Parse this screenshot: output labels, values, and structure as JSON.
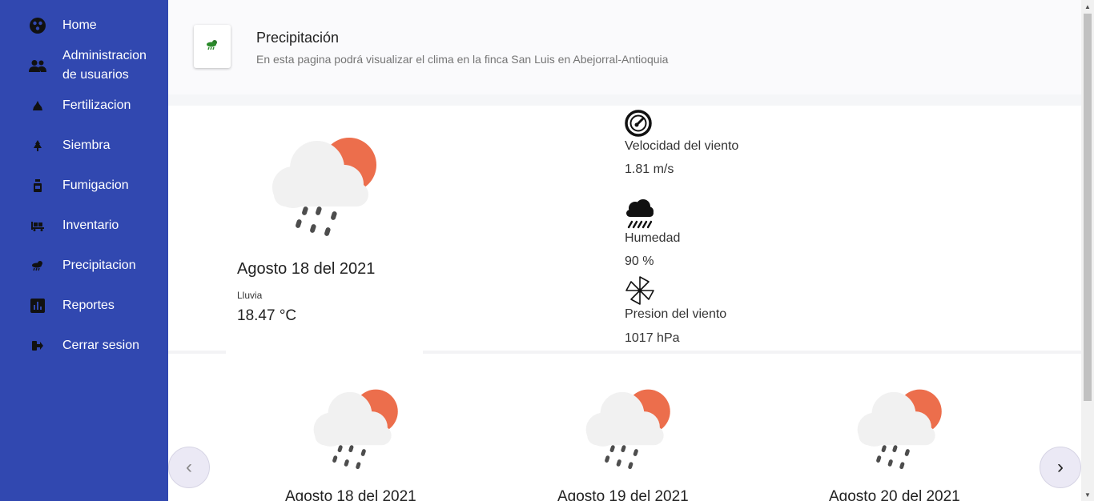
{
  "sidebar": {
    "items": [
      {
        "label": "Home",
        "icon": "home-icon"
      },
      {
        "label": "Administracion",
        "label2": "de usuarios",
        "icon": "users-icon"
      },
      {
        "label": "Fertilizacion",
        "icon": "fertilizer-icon"
      },
      {
        "label": "Siembra",
        "icon": "plant-icon"
      },
      {
        "label": "Fumigacion",
        "icon": "spray-icon"
      },
      {
        "label": "Inventario",
        "icon": "inventory-icon"
      },
      {
        "label": "Precipitacion",
        "icon": "rain-icon"
      },
      {
        "label": "Reportes",
        "icon": "chart-icon"
      },
      {
        "label": "Cerrar sesion",
        "icon": "logout-icon"
      }
    ]
  },
  "header": {
    "title": "Precipitación",
    "subtitle": "En esta pagina podrá visualizar el clima en la finca San Luis en Abejorral-Antioquia"
  },
  "current": {
    "date": "Agosto 18 del 2021",
    "condition": "Lluvia",
    "temperature": "18.47 °C"
  },
  "stats": {
    "wind_speed_label": "Velocidad del viento",
    "wind_speed_value": "1.81 m/s",
    "humidity_label": "Humedad",
    "humidity_value": "90 %",
    "pressure_label": "Presion del viento",
    "pressure_value": "1017 hPa"
  },
  "forecast": [
    {
      "date": "Agosto 18 del 2021"
    },
    {
      "date": "Agosto 19 del 2021"
    },
    {
      "date": "Agosto 20 del 2021"
    }
  ],
  "carousel": {
    "prev": "‹",
    "next": "›"
  },
  "colors": {
    "sidebar": "#3148b0",
    "sun": "#ec6e4c",
    "cloud": "#f1f1f1",
    "rain": "#4d4d4d"
  }
}
